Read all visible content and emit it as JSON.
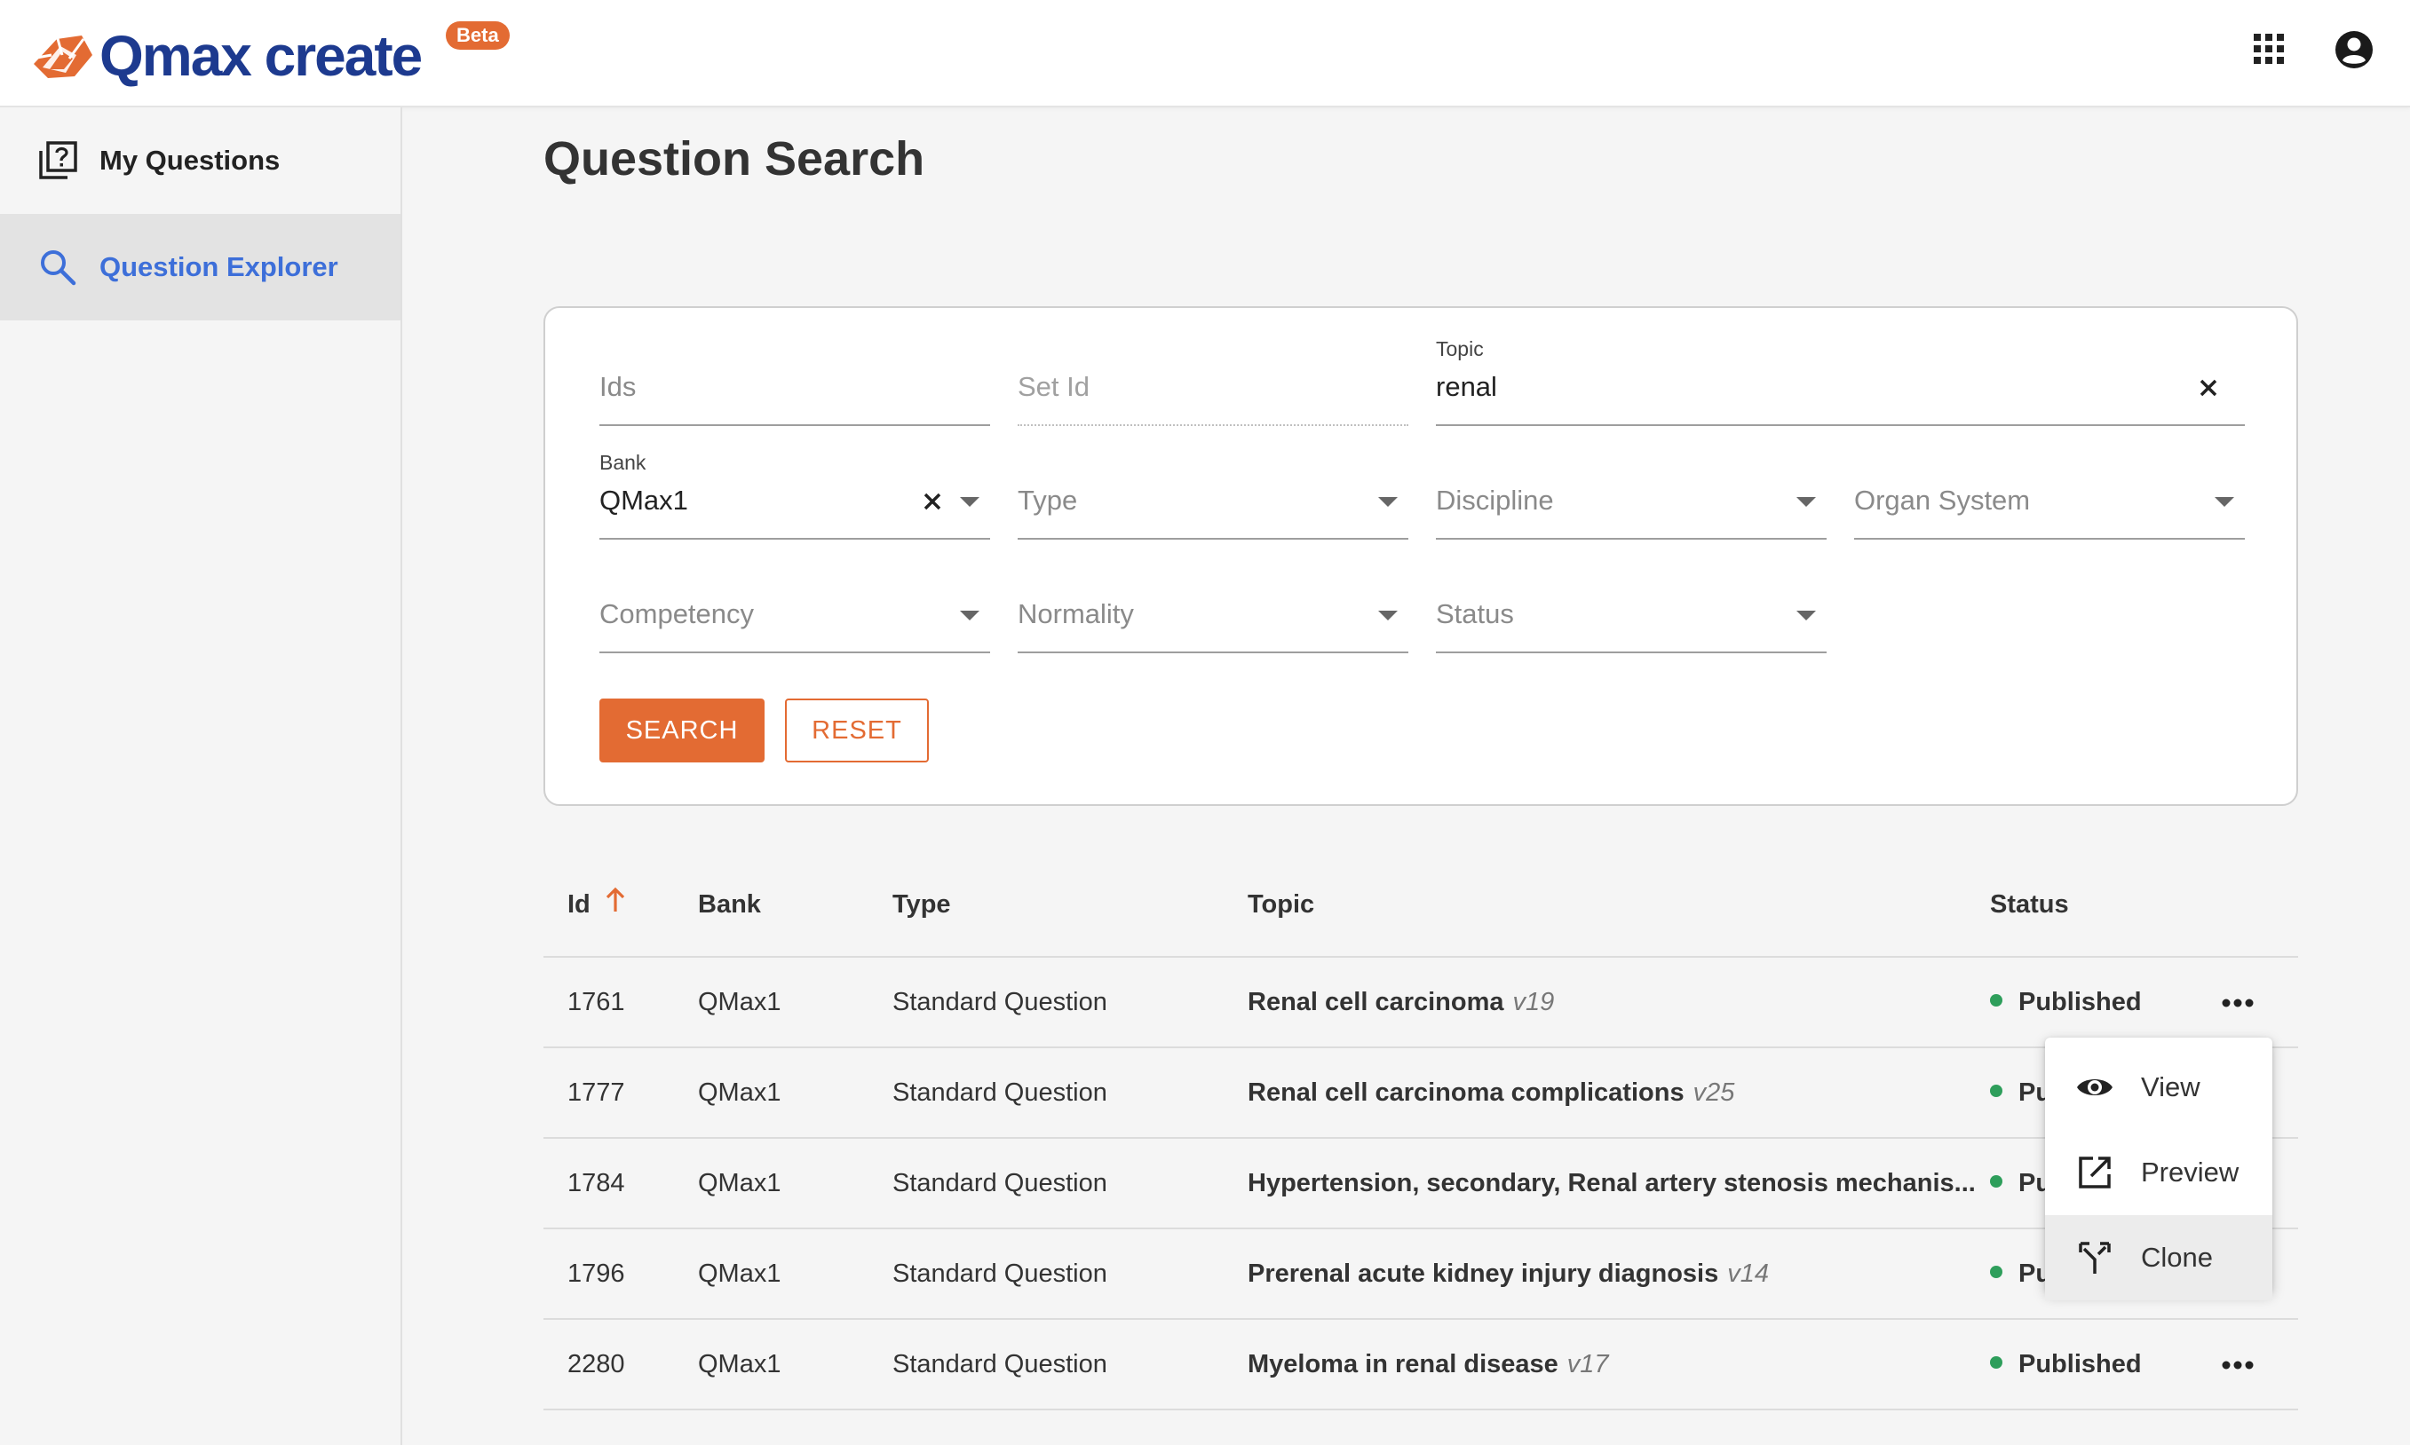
{
  "header": {
    "logo_text": "Qmax create",
    "beta_badge": "Beta",
    "brand_color": "#1d3a8f",
    "accent_color": "#e36b33",
    "icons": [
      "apps-grid-icon",
      "account-circle-icon"
    ]
  },
  "sidebar": {
    "items": [
      {
        "label": "My Questions",
        "icon": "question-bank-icon",
        "active": false
      },
      {
        "label": "Question Explorer",
        "icon": "search-icon",
        "active": true
      }
    ]
  },
  "main": {
    "title": "Question Search"
  },
  "search_form": {
    "ids": {
      "placeholder": "Ids",
      "value": ""
    },
    "set_id": {
      "placeholder": "Set Id",
      "value": ""
    },
    "topic": {
      "label": "Topic",
      "value": "renal"
    },
    "bank": {
      "label": "Bank",
      "value": "QMax1"
    },
    "type": {
      "placeholder": "Type"
    },
    "discipline": {
      "placeholder": "Discipline"
    },
    "organ_system": {
      "placeholder": "Organ System"
    },
    "competency": {
      "placeholder": "Competency"
    },
    "normality": {
      "placeholder": "Normality"
    },
    "status": {
      "placeholder": "Status"
    },
    "search_button": "SEARCH",
    "reset_button": "RESET"
  },
  "table": {
    "columns": {
      "id": "Id",
      "bank": "Bank",
      "type": "Type",
      "topic": "Topic",
      "status": "Status"
    },
    "sort": {
      "column": "Id",
      "direction": "ascending"
    },
    "rows": [
      {
        "id": "1761",
        "bank": "QMax1",
        "type": "Standard Question",
        "topic": "Renal cell carcinoma",
        "version": "v19",
        "status": "Published"
      },
      {
        "id": "1777",
        "bank": "QMax1",
        "type": "Standard Question",
        "topic": "Renal cell carcinoma complications",
        "version": "v25",
        "status": "Pu"
      },
      {
        "id": "1784",
        "bank": "QMax1",
        "type": "Standard Question",
        "topic": "Hypertension, secondary, Renal artery stenosis mechanis...",
        "version": "",
        "status": "Pu"
      },
      {
        "id": "1796",
        "bank": "QMax1",
        "type": "Standard Question",
        "topic": "Prerenal acute kidney injury diagnosis",
        "version": "v14",
        "status": "Pu"
      },
      {
        "id": "2280",
        "bank": "QMax1",
        "type": "Standard Question",
        "topic": "Myeloma in renal disease",
        "version": "v17",
        "status": "Published"
      }
    ],
    "status_color": "#2e9e5b"
  },
  "row_menu": {
    "items": [
      {
        "label": "View",
        "icon": "eye-icon"
      },
      {
        "label": "Preview",
        "icon": "open-in-new-icon"
      },
      {
        "label": "Clone",
        "icon": "fork-icon"
      }
    ],
    "highlighted": "Clone"
  }
}
